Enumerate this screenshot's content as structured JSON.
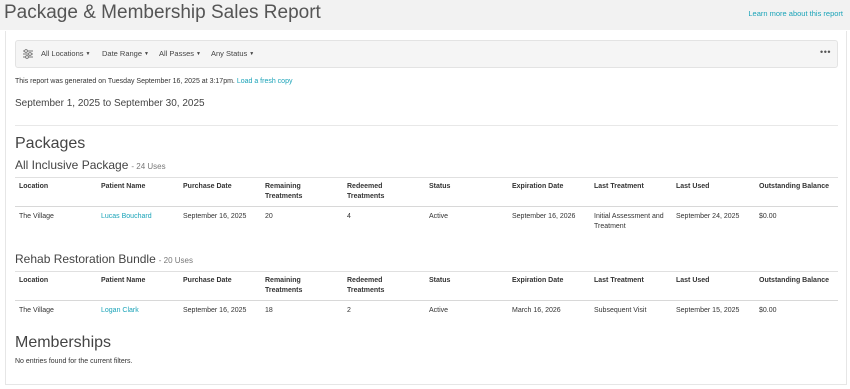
{
  "header": {
    "title": "Package & Membership Sales Report",
    "learn_more": "Learn more about this report"
  },
  "filters": {
    "items": [
      {
        "label": "All Locations"
      },
      {
        "label": "Date Range"
      },
      {
        "label": "All Passes"
      },
      {
        "label": "Any Status"
      }
    ],
    "more_label": "•••"
  },
  "report": {
    "generated_text": "This report was generated on Tuesday September 16, 2025 at 3:17pm.",
    "refresh_link": "Load a fresh copy",
    "date_range": "September 1, 2025 to September 30, 2025"
  },
  "packages": {
    "title": "Packages",
    "columns": [
      "Location",
      "Patient Name",
      "Purchase Date",
      "Remaining Treatments",
      "Redeemed Treatments",
      "Status",
      "Expiration Date",
      "Last Treatment",
      "Last Used",
      "Outstanding Balance"
    ],
    "groups": [
      {
        "name": "All Inclusive Package",
        "uses": "- 24 Uses",
        "rows": [
          {
            "location": "The Village",
            "patient": "Lucas Bouchard",
            "purchase_date": "September 16, 2025",
            "remaining": "20",
            "redeemed": "4",
            "status": "Active",
            "expiration": "September 16, 2026",
            "last_treatment": "Initial Assessment and Treatment",
            "last_used": "September 24, 2025",
            "balance": "$0.00"
          }
        ]
      },
      {
        "name": "Rehab Restoration Bundle",
        "uses": "- 20 Uses",
        "rows": [
          {
            "location": "The Village",
            "patient": "Logan Clark",
            "purchase_date": "September 16, 2025",
            "remaining": "18",
            "redeemed": "2",
            "status": "Active",
            "expiration": "March 16, 2026",
            "last_treatment": "Subsequent Visit",
            "last_used": "September 15, 2025",
            "balance": "$0.00"
          }
        ]
      }
    ]
  },
  "memberships": {
    "title": "Memberships",
    "empty_text": "No entries found for the current filters."
  },
  "colors": {
    "accent": "#1aa3b8",
    "page_band": "#f2f2f2"
  }
}
